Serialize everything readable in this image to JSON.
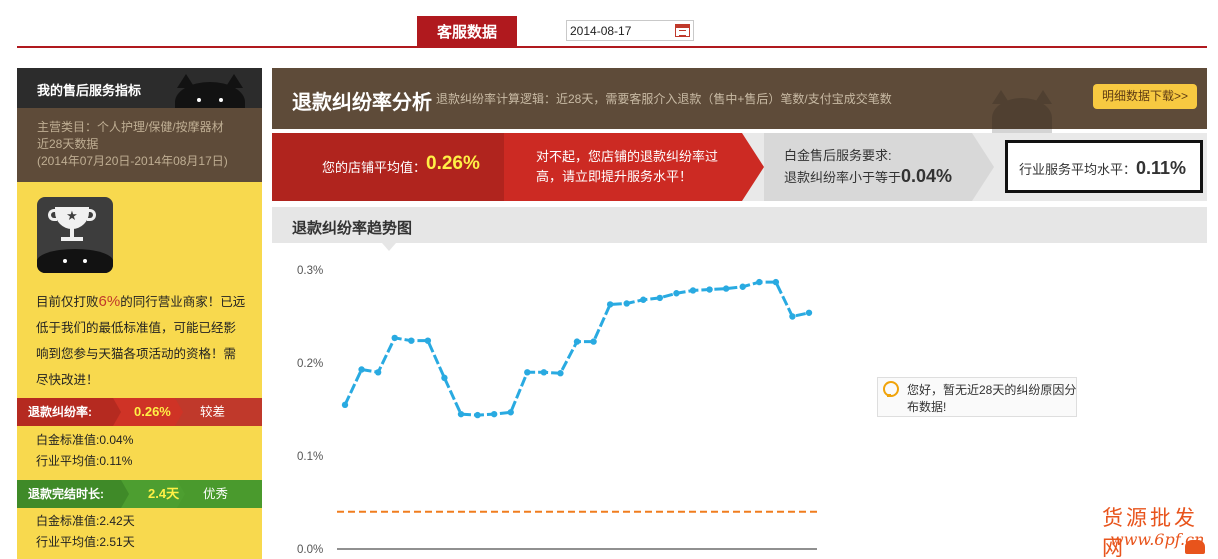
{
  "top": {
    "tab_label": "客服数据",
    "date_value": "2014-08-17"
  },
  "sidebar": {
    "title": "我的售后服务指标",
    "category_line": "主营类目：个人护理/保健/按摩器材",
    "range_line": "近28天数据",
    "date_range": "(2014年07月20日-2014年08月17日)",
    "message_before": "目前仅打败",
    "message_pct": "6%",
    "message_after": "的同行营业商家！已远低于我们的最低标准值，可能已经影响到您参与天猫各项活动的资格！需尽快改进！",
    "metric1": {
      "label": "退款纠纷率:",
      "value": "0.26%",
      "grade": "较差",
      "platinum": "白金标准值:0.04%",
      "industry": "行业平均值:0.11%"
    },
    "metric2": {
      "label": "退款完结时长:",
      "value": "2.4天",
      "grade": "优秀",
      "platinum": "白金标准值:2.42天",
      "industry": "行业平均值:2.51天"
    }
  },
  "main": {
    "title": "退款纠纷率分析",
    "subtitle": "退款纠纷率计算逻辑：近28天，需要客服介入退款（售中+售后）笔数/支付宝成交笔数",
    "download_label": "明细数据下载>>",
    "shop_avg_label": "您的店铺平均值：",
    "shop_avg_value": "0.26%",
    "warning_text": "对不起，您店铺的退款纠纷率过高，请立即提升服务水平！",
    "platinum_req_label": "白金售后服务要求:",
    "platinum_req_text": "退款纠纷率小于等于",
    "platinum_req_value": "0.04%",
    "industry_label": "行业服务平均水平：",
    "industry_value": "0.11%",
    "chart_title": "退款纠纷率趋势图",
    "tip_text": "您好，暂无近28天的纠纷原因分布数据!"
  },
  "watermark": {
    "line1": "货源批发网",
    "line2": "www.6pf.cn"
  },
  "colors": {
    "accent_red": "#b0191e",
    "brown": "#5e4b39",
    "yellow": "#f8d94e",
    "line": "#29aae1",
    "threshold": "#f07d1e"
  },
  "chart_data": {
    "type": "line",
    "ylim": [
      0,
      0.3
    ],
    "yticks": [
      "0.0%",
      "0.1%",
      "0.2%",
      "0.3%"
    ],
    "values": [
      0.155,
      0.193,
      0.19,
      0.227,
      0.224,
      0.224,
      0.184,
      0.145,
      0.144,
      0.145,
      0.147,
      0.19,
      0.19,
      0.189,
      0.223,
      0.223,
      0.263,
      0.264,
      0.268,
      0.27,
      0.275,
      0.278,
      0.279,
      0.28,
      0.282,
      0.287,
      0.287,
      0.25,
      0.254
    ],
    "threshold_value": 0.04
  }
}
